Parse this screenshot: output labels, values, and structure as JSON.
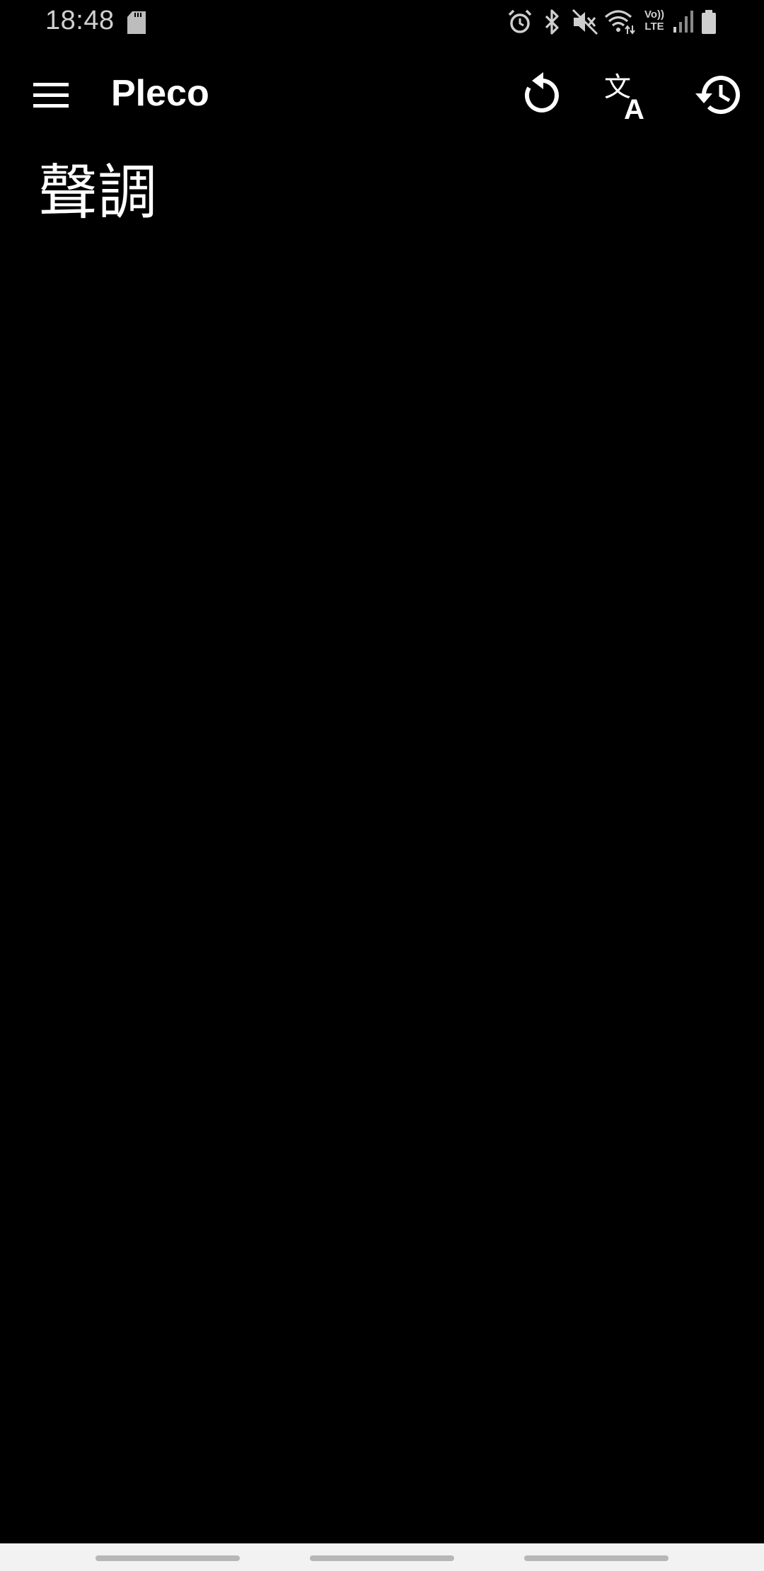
{
  "status_bar": {
    "time": "18:48",
    "network_label_line1": "Vo))",
    "network_label_line2": "LTE",
    "icons": [
      "sd-card-icon",
      "alarm-icon",
      "bluetooth-icon",
      "mute-icon",
      "wifi-icon",
      "lte-icon",
      "signal-icon",
      "battery-icon"
    ]
  },
  "app_bar": {
    "title": "Pleco",
    "icons": [
      "menu-icon",
      "refresh-icon",
      "translate-icon",
      "history-icon"
    ]
  },
  "main": {
    "entry_text": "聲調"
  },
  "colors": {
    "background": "#000000",
    "foreground": "#ffffff",
    "status_text": "#d0d0d0",
    "nav_bar": "#f2f2f2",
    "nav_pill": "#b7b7b7"
  }
}
